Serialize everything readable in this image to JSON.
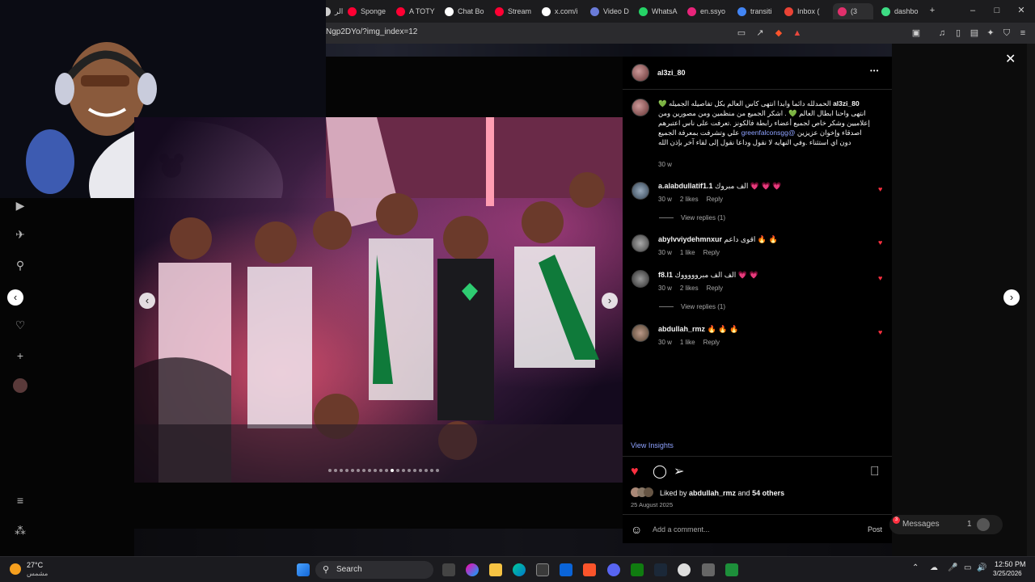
{
  "browser": {
    "tabs": [
      {
        "label": "الر",
        "color": "#cccccc"
      },
      {
        "label": "Sponge",
        "color": "#ff0033"
      },
      {
        "label": "A TOTY",
        "color": "#ff0033"
      },
      {
        "label": "Chat Bo",
        "color": "#ffffff"
      },
      {
        "label": "Stream",
        "color": "#ff0033"
      },
      {
        "label": "x.com/i",
        "color": "#ffffff"
      },
      {
        "label": "Video D",
        "color": "#6a7bd8"
      },
      {
        "label": "WhatsA",
        "color": "#25d366"
      },
      {
        "label": "en.ssyo",
        "color": "#e8247a"
      },
      {
        "label": "transiti",
        "color": "#4285f4"
      },
      {
        "label": "Inbox (",
        "color": "#ea4335"
      },
      {
        "label": "(3",
        "color": "#e1306c"
      },
      {
        "label": "dashbo",
        "color": "#3ddc84"
      }
    ],
    "url": "Ngp2DYo/?img_index=12"
  },
  "post": {
    "author": "al3zi_80",
    "caption_user": "al3zi_80",
    "caption_text": "الحمدلله دائما وابدا انتهى كاس العالم بكل تفاصيله الجميله 💚 انتهى واحنا ابطال العالم 💚 . اشكر الجميع من منظمين ومن مصورين ومن إعلاميين وشكر خاص لجميع أعضاء رابطة فالكونز .تعرفت على ناس اعتبرهم اصدقاء وإخوان عزيزين",
    "caption_link": "@greenfalconsgg",
    "caption_text2": "علي وتشرفت بمعرفة الجميع دون اي استثناء .وفي النهايه لا نقول وداعا نقول إلى لقاء آخر بإذن الله",
    "caption_time": "30 w",
    "view_insights": "View Insights",
    "liked_by_prefix": "Liked by ",
    "liked_by_user": "abdullah_rmz",
    "liked_by_and": " and ",
    "liked_by_others": "54 others",
    "date": "25 August 2025",
    "add_comment_placeholder": "Add a comment...",
    "post_button": "Post",
    "more": "•••"
  },
  "comments": [
    {
      "user": "a.alabdullatif1.1",
      "text": "الف مبروك 💗 💗 💗",
      "time": "30 w",
      "likes": "2 likes",
      "reply": "Reply",
      "view_replies": "View replies (1)"
    },
    {
      "user": "abylvviydehmnxur",
      "text": "اقوى داعم 🔥 🔥",
      "time": "30 w",
      "likes": "1 like",
      "reply": "Reply",
      "view_replies": ""
    },
    {
      "user": "f8.l1",
      "text": "الف الف مبروووووك 💗 💗",
      "time": "30 w",
      "likes": "2 likes",
      "reply": "Reply",
      "view_replies": "View replies (1)"
    },
    {
      "user": "abdullah_rmz",
      "text": "🔥 🔥 🔥",
      "time": "30 w",
      "likes": "1 like",
      "reply": "Reply",
      "view_replies": ""
    }
  ],
  "messages": {
    "label": "Messages",
    "count": "1",
    "badge": "3"
  },
  "taskbar": {
    "weather_temp": "27°C",
    "weather_desc": "مشمس",
    "search": "Search",
    "time": "12:50 PM",
    "date": "3/25/2026"
  },
  "photo_dots": {
    "count": 20,
    "active_index": 11
  }
}
